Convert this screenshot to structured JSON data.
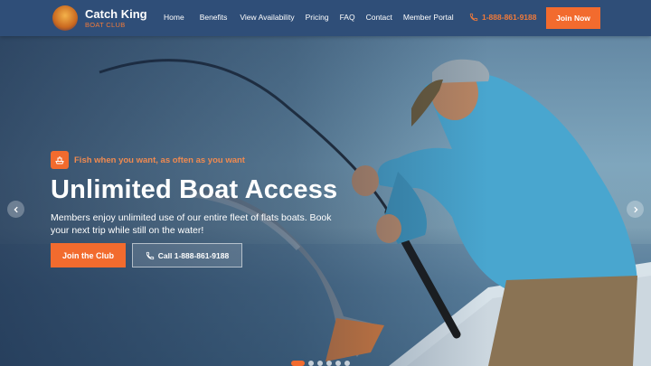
{
  "brand": {
    "name": "Catch King",
    "sub": "BOAT CLUB",
    "logo_icon": "fish-crown-logo"
  },
  "nav": {
    "items": [
      "Home",
      "Benefits",
      "View Availability",
      "Pricing",
      "FAQ",
      "Contact",
      "Member Portal"
    ],
    "phone": "1-888-861-9188",
    "phone_icon": "phone-icon",
    "cta": "Join Now"
  },
  "hero": {
    "tagline": "Fish when you want, as often as you want",
    "tag_icon": "boat-icon",
    "headline": "Unlimited Boat Access",
    "subtext": "Members enjoy unlimited use of our entire fleet of flats boats. Book your next trip while still on the water!",
    "primary_button": "Join the Club",
    "secondary_button": "Call 1-888-861-9188",
    "slides_total": 6,
    "active_slide": 1
  },
  "colors": {
    "nav_bg": "#2f4e78",
    "accent": "#f26b2e",
    "tagline": "#f08a50",
    "text": "#ffffff"
  }
}
